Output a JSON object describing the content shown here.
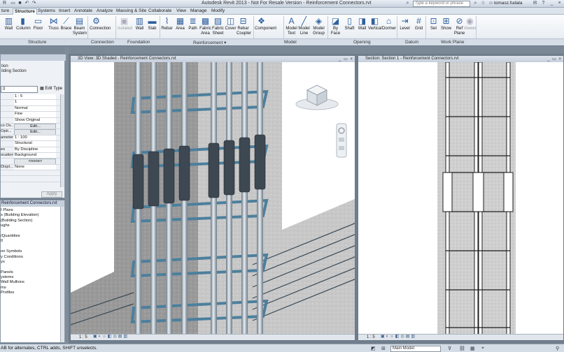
{
  "titlebar": {
    "title": "Autodesk Revit 2013 - Not For Resale Version -  Reinforcement Connectors.rvt",
    "search_placeholder": "Type a keyword or phrase",
    "user": "tomasz.fudala"
  },
  "tabs": [
    "ture",
    "Structure",
    "Systems",
    "Insert",
    "Annotate",
    "Analyze",
    "Massing & Site",
    "Collaborate",
    "View",
    "Manage",
    "Modify"
  ],
  "active_tab": "Structure",
  "ribbon": {
    "buttons": [
      {
        "label": "Wall",
        "icon": "wall-icon"
      },
      {
        "label": "Column",
        "icon": "column-icon"
      },
      {
        "label": "Floor",
        "icon": "floor-icon"
      },
      {
        "label": "Truss",
        "icon": "truss-icon"
      },
      {
        "label": "Brace",
        "icon": "brace-icon"
      },
      {
        "label": "Beam System",
        "icon": "beam-system-icon"
      },
      {
        "label": "Connection",
        "icon": "connection-icon"
      },
      {
        "label": "Isolated",
        "icon": "isolated-foundation-icon",
        "disabled": true
      },
      {
        "label": "Wall",
        "icon": "wall-foundation-icon"
      },
      {
        "label": "Slab",
        "icon": "slab-icon"
      },
      {
        "label": "Rebar",
        "icon": "rebar-icon"
      },
      {
        "label": "Area",
        "icon": "area-reinforcement-icon"
      },
      {
        "label": "Path",
        "icon": "path-reinforcement-icon"
      },
      {
        "label": "Fabric Area",
        "icon": "fabric-area-icon"
      },
      {
        "label": "Fabric Sheet",
        "icon": "fabric-sheet-icon"
      },
      {
        "label": "Cover",
        "icon": "cover-icon"
      },
      {
        "label": "Rebar Coupler",
        "icon": "rebar-coupler-icon"
      },
      {
        "label": "Component",
        "icon": "component-icon"
      },
      {
        "label": "Model Text",
        "icon": "model-text-icon"
      },
      {
        "label": "Model Line",
        "icon": "model-line-icon"
      },
      {
        "label": "Model Group",
        "icon": "model-group-icon"
      },
      {
        "label": "By Face",
        "icon": "by-face-icon"
      },
      {
        "label": "Shaft",
        "icon": "shaft-icon"
      },
      {
        "label": "Wall",
        "icon": "wall-opening-icon"
      },
      {
        "label": "Vertical",
        "icon": "vertical-opening-icon"
      },
      {
        "label": "Dormer",
        "icon": "dormer-icon"
      },
      {
        "label": "Level",
        "icon": "level-icon"
      },
      {
        "label": "Grid",
        "icon": "grid-icon"
      },
      {
        "label": "Set",
        "icon": "set-icon"
      },
      {
        "label": "Show",
        "icon": "show-icon"
      },
      {
        "label": "Ref Plane",
        "icon": "ref-plane-icon"
      },
      {
        "label": "Viewer",
        "icon": "viewer-icon",
        "disabled": true
      }
    ],
    "panels": [
      "Structure",
      "Connection",
      "Foundation",
      "Reinforcement ▾",
      "Model",
      "Opening",
      "Datum",
      "Work Plane"
    ]
  },
  "properties": {
    "type_line1": "tion",
    "type_line2": "ilding Section",
    "combo_value": "0",
    "edit_type": "Edit Type",
    "rows": [
      {
        "k": "",
        "v": "1 : 5"
      },
      {
        "k": "",
        "v": "1"
      },
      {
        "k": "",
        "v": "Normal"
      },
      {
        "k": "",
        "v": "Fine"
      },
      {
        "k": "",
        "v": "Show Original"
      },
      {
        "k": "cs Ov...",
        "v": "Edit...",
        "btn": true
      },
      {
        "k": "Opti...",
        "v": "Edit...",
        "btn": true
      },
      {
        "k": "ameter...",
        "v": "1 : 100"
      },
      {
        "k": "",
        "v": "Structural"
      },
      {
        "k": "es",
        "v": "By Discipline"
      },
      {
        "k": "ocation",
        "v": "Background"
      },
      {
        "k": "",
        "v": "<none>",
        "btn": true
      },
      {
        "k": "Displ...",
        "v": "None"
      },
      {
        "k": "",
        "v": ""
      },
      {
        "k": "",
        "v": ""
      }
    ],
    "apply": "Apply"
  },
  "browser": {
    "title": "Reinforcement Connectors.rvt",
    "items": [
      "I Plans",
      "s (Building Elevation)",
      "(Building Section)",
      "ughs",
      "",
      "/Quantities",
      "0",
      "",
      "on Symbols",
      "y Conditions",
      "ys",
      "",
      "Panels",
      "ystems",
      "Wall Mullions",
      "ms",
      " Profiles"
    ]
  },
  "view3d": {
    "title": "3D View: 3D Shaded - Reinforcement Connectors.rvt",
    "scale": "1 : 5"
  },
  "viewsec": {
    "title": "Section: Section 1 - Reinforcement Connectors.rvt",
    "scale": "1 : 5"
  },
  "statusbar": {
    "message": "AB for alternates, CTRL adds, SHIFT unselects.",
    "model": "Main Model"
  }
}
